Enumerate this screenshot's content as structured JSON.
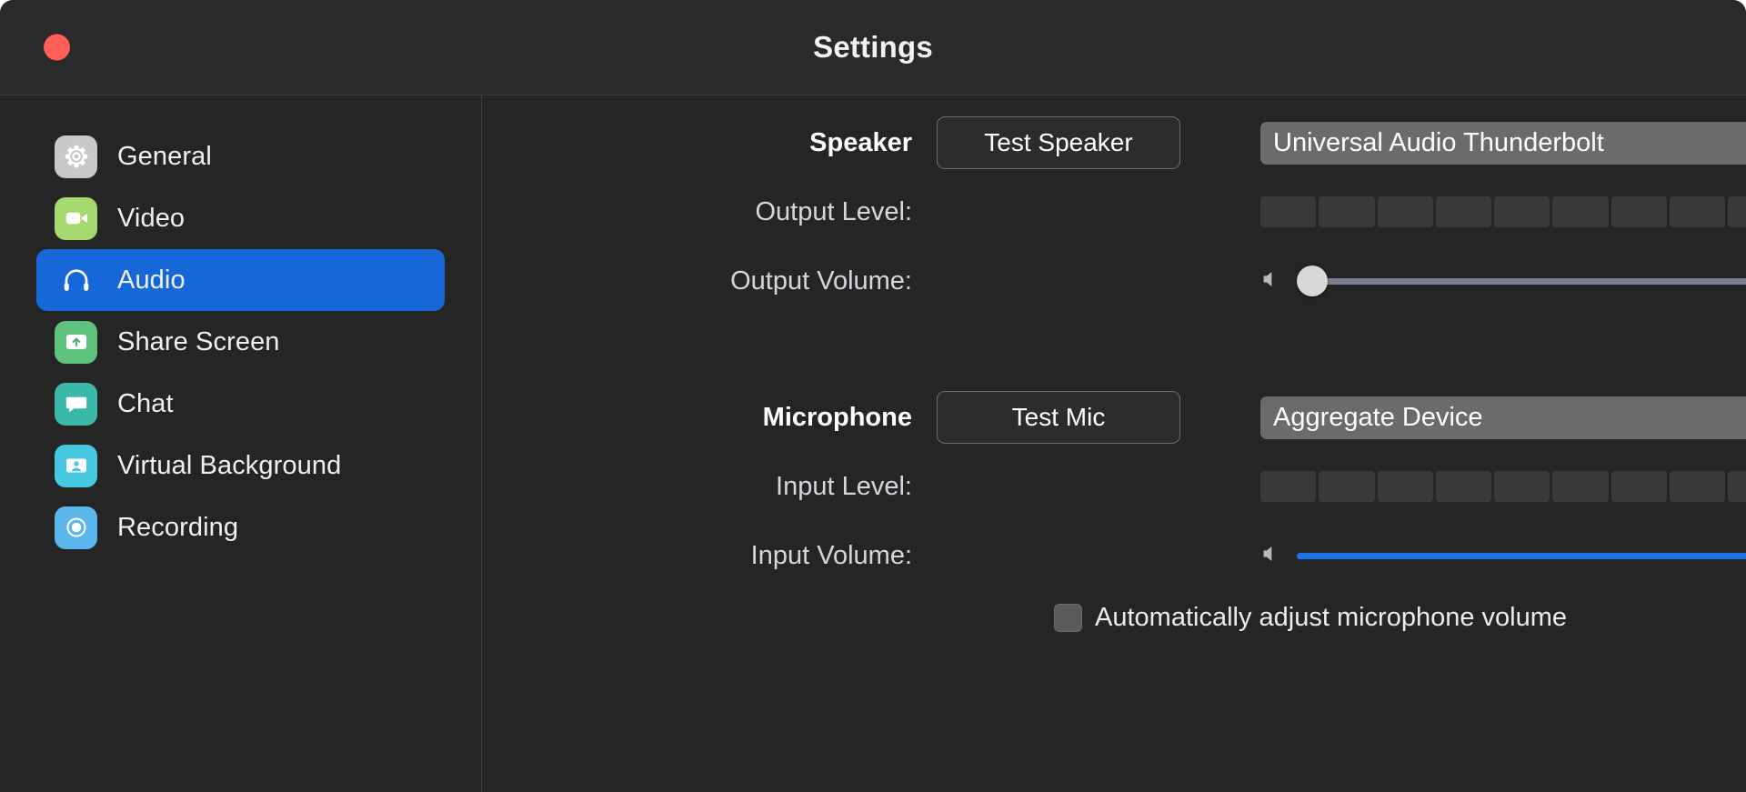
{
  "window": {
    "title": "Settings",
    "traffic_lights": [
      {
        "name": "close",
        "color": "#ff5f57"
      }
    ]
  },
  "sidebar": {
    "items": [
      {
        "label": "General",
        "icon": "gear-icon",
        "icon_bg": "#c8c8c8",
        "active": false
      },
      {
        "label": "Video",
        "icon": "video-camera-icon",
        "icon_bg": "#a5d86e",
        "active": false
      },
      {
        "label": "Audio",
        "icon": "headphones-icon",
        "icon_bg": "#1667d8",
        "active": true
      },
      {
        "label": "Share Screen",
        "icon": "share-screen-icon",
        "icon_bg": "#5dc27e",
        "active": false
      },
      {
        "label": "Chat",
        "icon": "chat-bubble-icon",
        "icon_bg": "#3bb8a8",
        "active": false
      },
      {
        "label": "Virtual Background",
        "icon": "person-frame-icon",
        "icon_bg": "#45c8e0",
        "active": false
      },
      {
        "label": "Recording",
        "icon": "record-circle-icon",
        "icon_bg": "#5bb8ec",
        "active": false
      }
    ],
    "active_accent": "#1667d8"
  },
  "main": {
    "speaker": {
      "label": "Speaker",
      "test_button": "Test Speaker",
      "device": "Universal Audio Thunderbolt",
      "output_level": {
        "label": "Output Level:",
        "segments": 10,
        "filled": 0
      },
      "output_volume": {
        "label": "Output Volume:",
        "value": 3,
        "min": 0,
        "max": 100,
        "fill": false
      }
    },
    "microphone": {
      "label": "Microphone",
      "test_button": "Test Mic",
      "device": "Aggregate Device",
      "input_level": {
        "label": "Input Level:",
        "segments": 10,
        "filled": 0
      },
      "input_volume": {
        "label": "Input Volume:",
        "value": 97,
        "min": 0,
        "max": 100,
        "fill": true
      },
      "auto_adjust": {
        "label": "Automatically adjust microphone volume",
        "checked": false
      }
    }
  },
  "colors": {
    "window_bg": "#252525",
    "titlebar_bg": "#2a2a2a",
    "accent_blue": "#1667d8",
    "slider_blue": "#1a73e8",
    "select_bg": "#6b6b6b",
    "meter_segment": "#3a3a3a"
  }
}
